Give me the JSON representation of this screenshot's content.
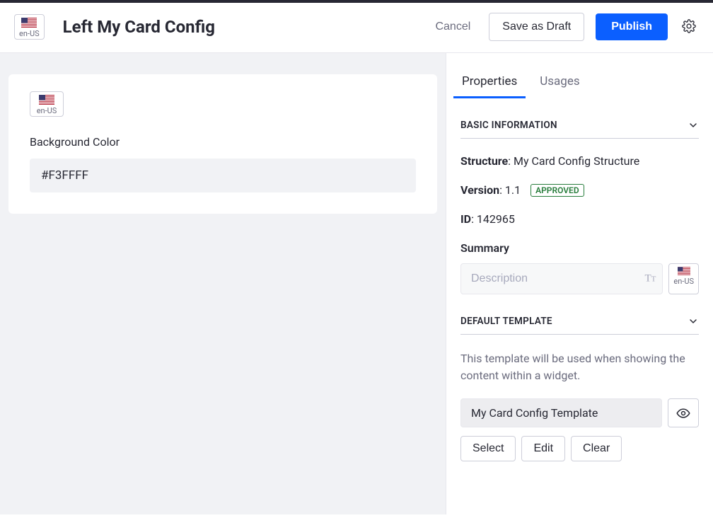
{
  "header": {
    "locale": "en-US",
    "title": "Left My Card Config",
    "cancel_label": "Cancel",
    "save_draft_label": "Save as Draft",
    "publish_label": "Publish"
  },
  "content": {
    "locale": "en-US",
    "bg_label": "Background Color",
    "bg_value": "#F3FFFF"
  },
  "sidebar": {
    "tabs": {
      "properties": "Properties",
      "usages": "Usages"
    },
    "basic": {
      "title": "BASIC INFORMATION",
      "structure_label": "Structure",
      "structure_value": "My Card Config Structure",
      "version_label": "Version",
      "version_value": "1.1",
      "approved": "APPROVED",
      "id_label": "ID",
      "id_value": "142965",
      "summary_label": "Summary",
      "summary_placeholder": "Description",
      "summary_locale": "en-US"
    },
    "template": {
      "title": "DEFAULT TEMPLATE",
      "description": "This template will be used when showing the content within a widget.",
      "name": "My Card Config Template",
      "select_label": "Select",
      "edit_label": "Edit",
      "clear_label": "Clear"
    }
  }
}
